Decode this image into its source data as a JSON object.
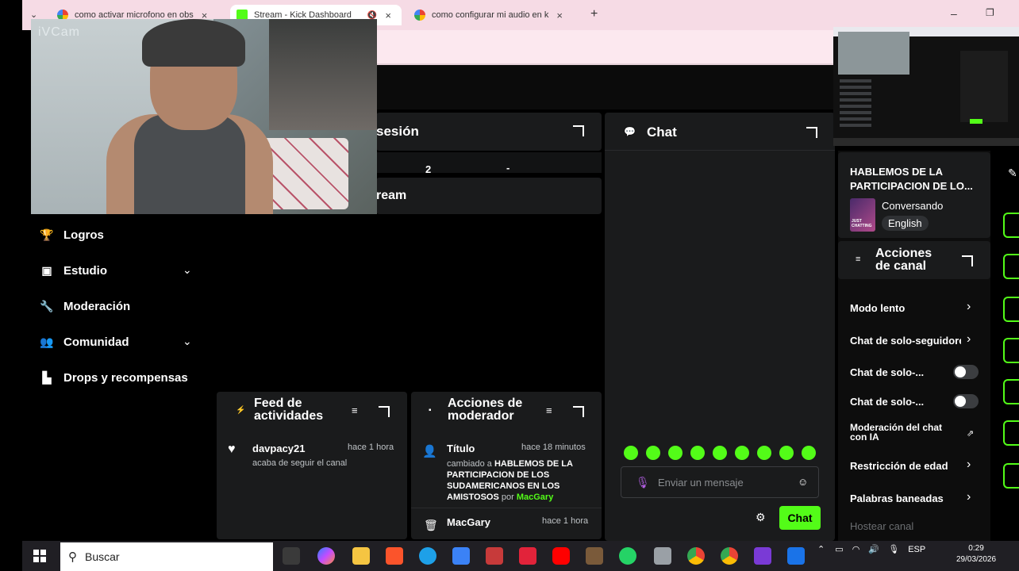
{
  "browser": {
    "tabs": [
      {
        "title": "como activar microfono en obs"
      },
      {
        "title": "Stream - Kick Dashboard"
      },
      {
        "title": "como configurar mi audio en k"
      }
    ],
    "new_tab_symbol": "+"
  },
  "webcam": {
    "overlay_label": "iVCam"
  },
  "sidebar": {
    "items": [
      {
        "label": "Logros",
        "icon": "trophy-icon"
      },
      {
        "label": "Estudio",
        "icon": "studio-icon"
      },
      {
        "label": "Moderación",
        "icon": "wrench-icon"
      },
      {
        "label": "Comunidad",
        "icon": "community-icon"
      },
      {
        "label": "Drops y recompensas",
        "icon": "drops-icon"
      }
    ]
  },
  "session": {
    "title_fragment": "sesión",
    "stat_value": "2",
    "stat_dash": "-",
    "stream_fragment": "ream"
  },
  "chat": {
    "title": "Chat",
    "input_placeholder": "Enviar un mensaje",
    "send_label": "Chat"
  },
  "feed": {
    "title": "Feed de actividades",
    "items": [
      {
        "user": "davpacy21",
        "time": "hace 1 hora",
        "text": "acaba de seguir el canal"
      }
    ]
  },
  "mod_actions": {
    "title": "Acciones de moderador",
    "items": [
      {
        "label": "Título",
        "time": "hace 18 minutos",
        "prefix": "cambiado a",
        "value": "HABLEMOS DE LA PARTICIPACION DE LOS SUDAMERICANOS EN LOS AMISTOSOS",
        "by": "por",
        "user": "MacGary"
      },
      {
        "label": "MacGary",
        "time": "hace 1 hora"
      }
    ]
  },
  "stream_info": {
    "title": "HABLEMOS DE LA PARTICIPACION DE LO...",
    "category": "Conversando",
    "language": "English",
    "thumb_label": "JUST CHATTING"
  },
  "channel_actions": {
    "title": "Acciones de canal",
    "items": [
      {
        "label": "Modo lento"
      },
      {
        "label": "Chat de solo-seguidores"
      },
      {
        "label": "Chat de solo-..."
      },
      {
        "label": "Chat de solo-..."
      },
      {
        "label": "Moderación del chat con IA"
      },
      {
        "label": "Restricción de edad"
      },
      {
        "label": "Palabras baneadas"
      },
      {
        "label": "Hostear canal"
      }
    ]
  },
  "taskbar": {
    "search_placeholder": "Buscar",
    "tray_lang": "ESP",
    "clock_time": "0:29",
    "clock_date": "29/03/2026"
  },
  "colors": {
    "accent": "#53fc18",
    "panel": "#1a1b1c",
    "tab_bar": "#f6dbe5"
  }
}
